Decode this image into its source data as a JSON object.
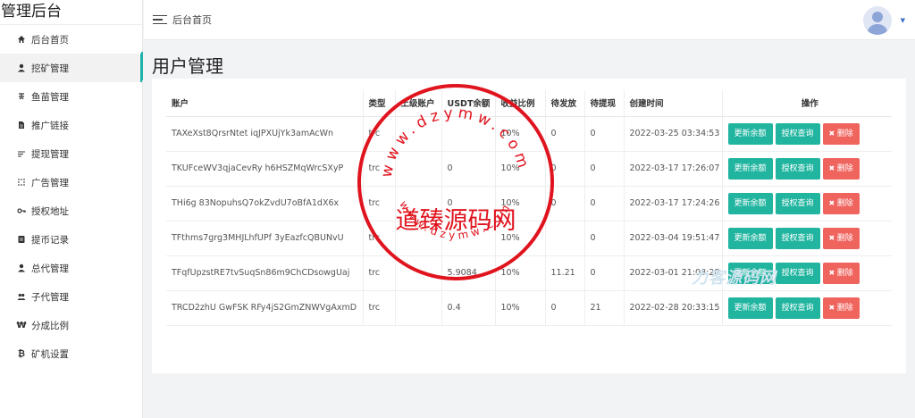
{
  "sidebar": {
    "brand": "管理后台",
    "items": [
      {
        "label": "后台首页",
        "icon": "home-icon"
      },
      {
        "label": "挖矿管理",
        "icon": "user-icon"
      },
      {
        "label": "鱼苗管理",
        "icon": "fish-icon"
      },
      {
        "label": "推广链接",
        "icon": "file-icon"
      },
      {
        "label": "提现管理",
        "icon": "list-icon"
      },
      {
        "label": "广告管理",
        "icon": "grid-icon"
      },
      {
        "label": "授权地址",
        "icon": "key-icon"
      },
      {
        "label": "提币记录",
        "icon": "record-icon"
      },
      {
        "label": "总代管理",
        "icon": "user-icon"
      },
      {
        "label": "子代管理",
        "icon": "users-icon"
      },
      {
        "label": "分成比例",
        "icon": "won-icon"
      },
      {
        "label": "矿机设置",
        "icon": "bitcoin-icon"
      }
    ]
  },
  "header": {
    "breadcrumb": "后台首页"
  },
  "main": {
    "title": "用户管理"
  },
  "table": {
    "headers": [
      "账户",
      "类型",
      "上级账户",
      "USDT余额",
      "收益比例",
      "待发放",
      "待提现",
      "创建时间",
      "操作"
    ],
    "rows": [
      {
        "account": "TAXeXst8QrsrNtet  iqJPXUjYk3amAcWn",
        "type": "trc",
        "parent": "",
        "usdt": "",
        "ratio": "10%",
        "pending": "0",
        "withdraw": "0",
        "created": "2022-03-25 03:34:53"
      },
      {
        "account": "TKUFceWV3qjaCevRy  h6HSZMqWrcSXyP",
        "type": "trc",
        "parent": "",
        "usdt": "0",
        "ratio": "10%",
        "pending": "0",
        "withdraw": "0",
        "created": "2022-03-17 17:26:07"
      },
      {
        "account": "THi6g  83NopuhsQ7okZvdU7oBfA1dX6x",
        "type": "trc",
        "parent": "",
        "usdt": "0",
        "ratio": "10%",
        "pending": "0",
        "withdraw": "0",
        "created": "2022-03-17 17:24:26"
      },
      {
        "account": "TFthms7grg3MHJLhfUPf  3yEazfcQBUNvU",
        "type": "trc",
        "parent": "",
        "usdt": "",
        "ratio": "10%",
        "pending": "",
        "withdraw": "0",
        "created": "2022-03-04 19:51:47"
      },
      {
        "account": "TFqfUpzstRE7tvSuqSn86m9ChCDsowgUaj",
        "type": "trc",
        "parent": "",
        "usdt": "5.9084",
        "ratio": "10%",
        "pending": "11.21",
        "withdraw": "0",
        "created": "2022-03-01 21:08:28"
      },
      {
        "account": "TRCD2zhU  GwFSK  RFy4jS2GmZNWVgAxmD",
        "type": "trc",
        "parent": "",
        "usdt": "0.4",
        "ratio": "10%",
        "pending": "0",
        "withdraw": "21",
        "created": "2022-02-28 20:33:15"
      }
    ],
    "actions": {
      "refresh": "更新余额",
      "auth": "授权查询",
      "delete": "删除"
    }
  },
  "stamp": {
    "center": "道臻源码网",
    "ring_top": "www.dzymw.com",
    "ring_bottom": "www.dzymw.com",
    "color": "#e0141e"
  },
  "accent_color": "#20b2aa",
  "danger_color": "#f0645e"
}
